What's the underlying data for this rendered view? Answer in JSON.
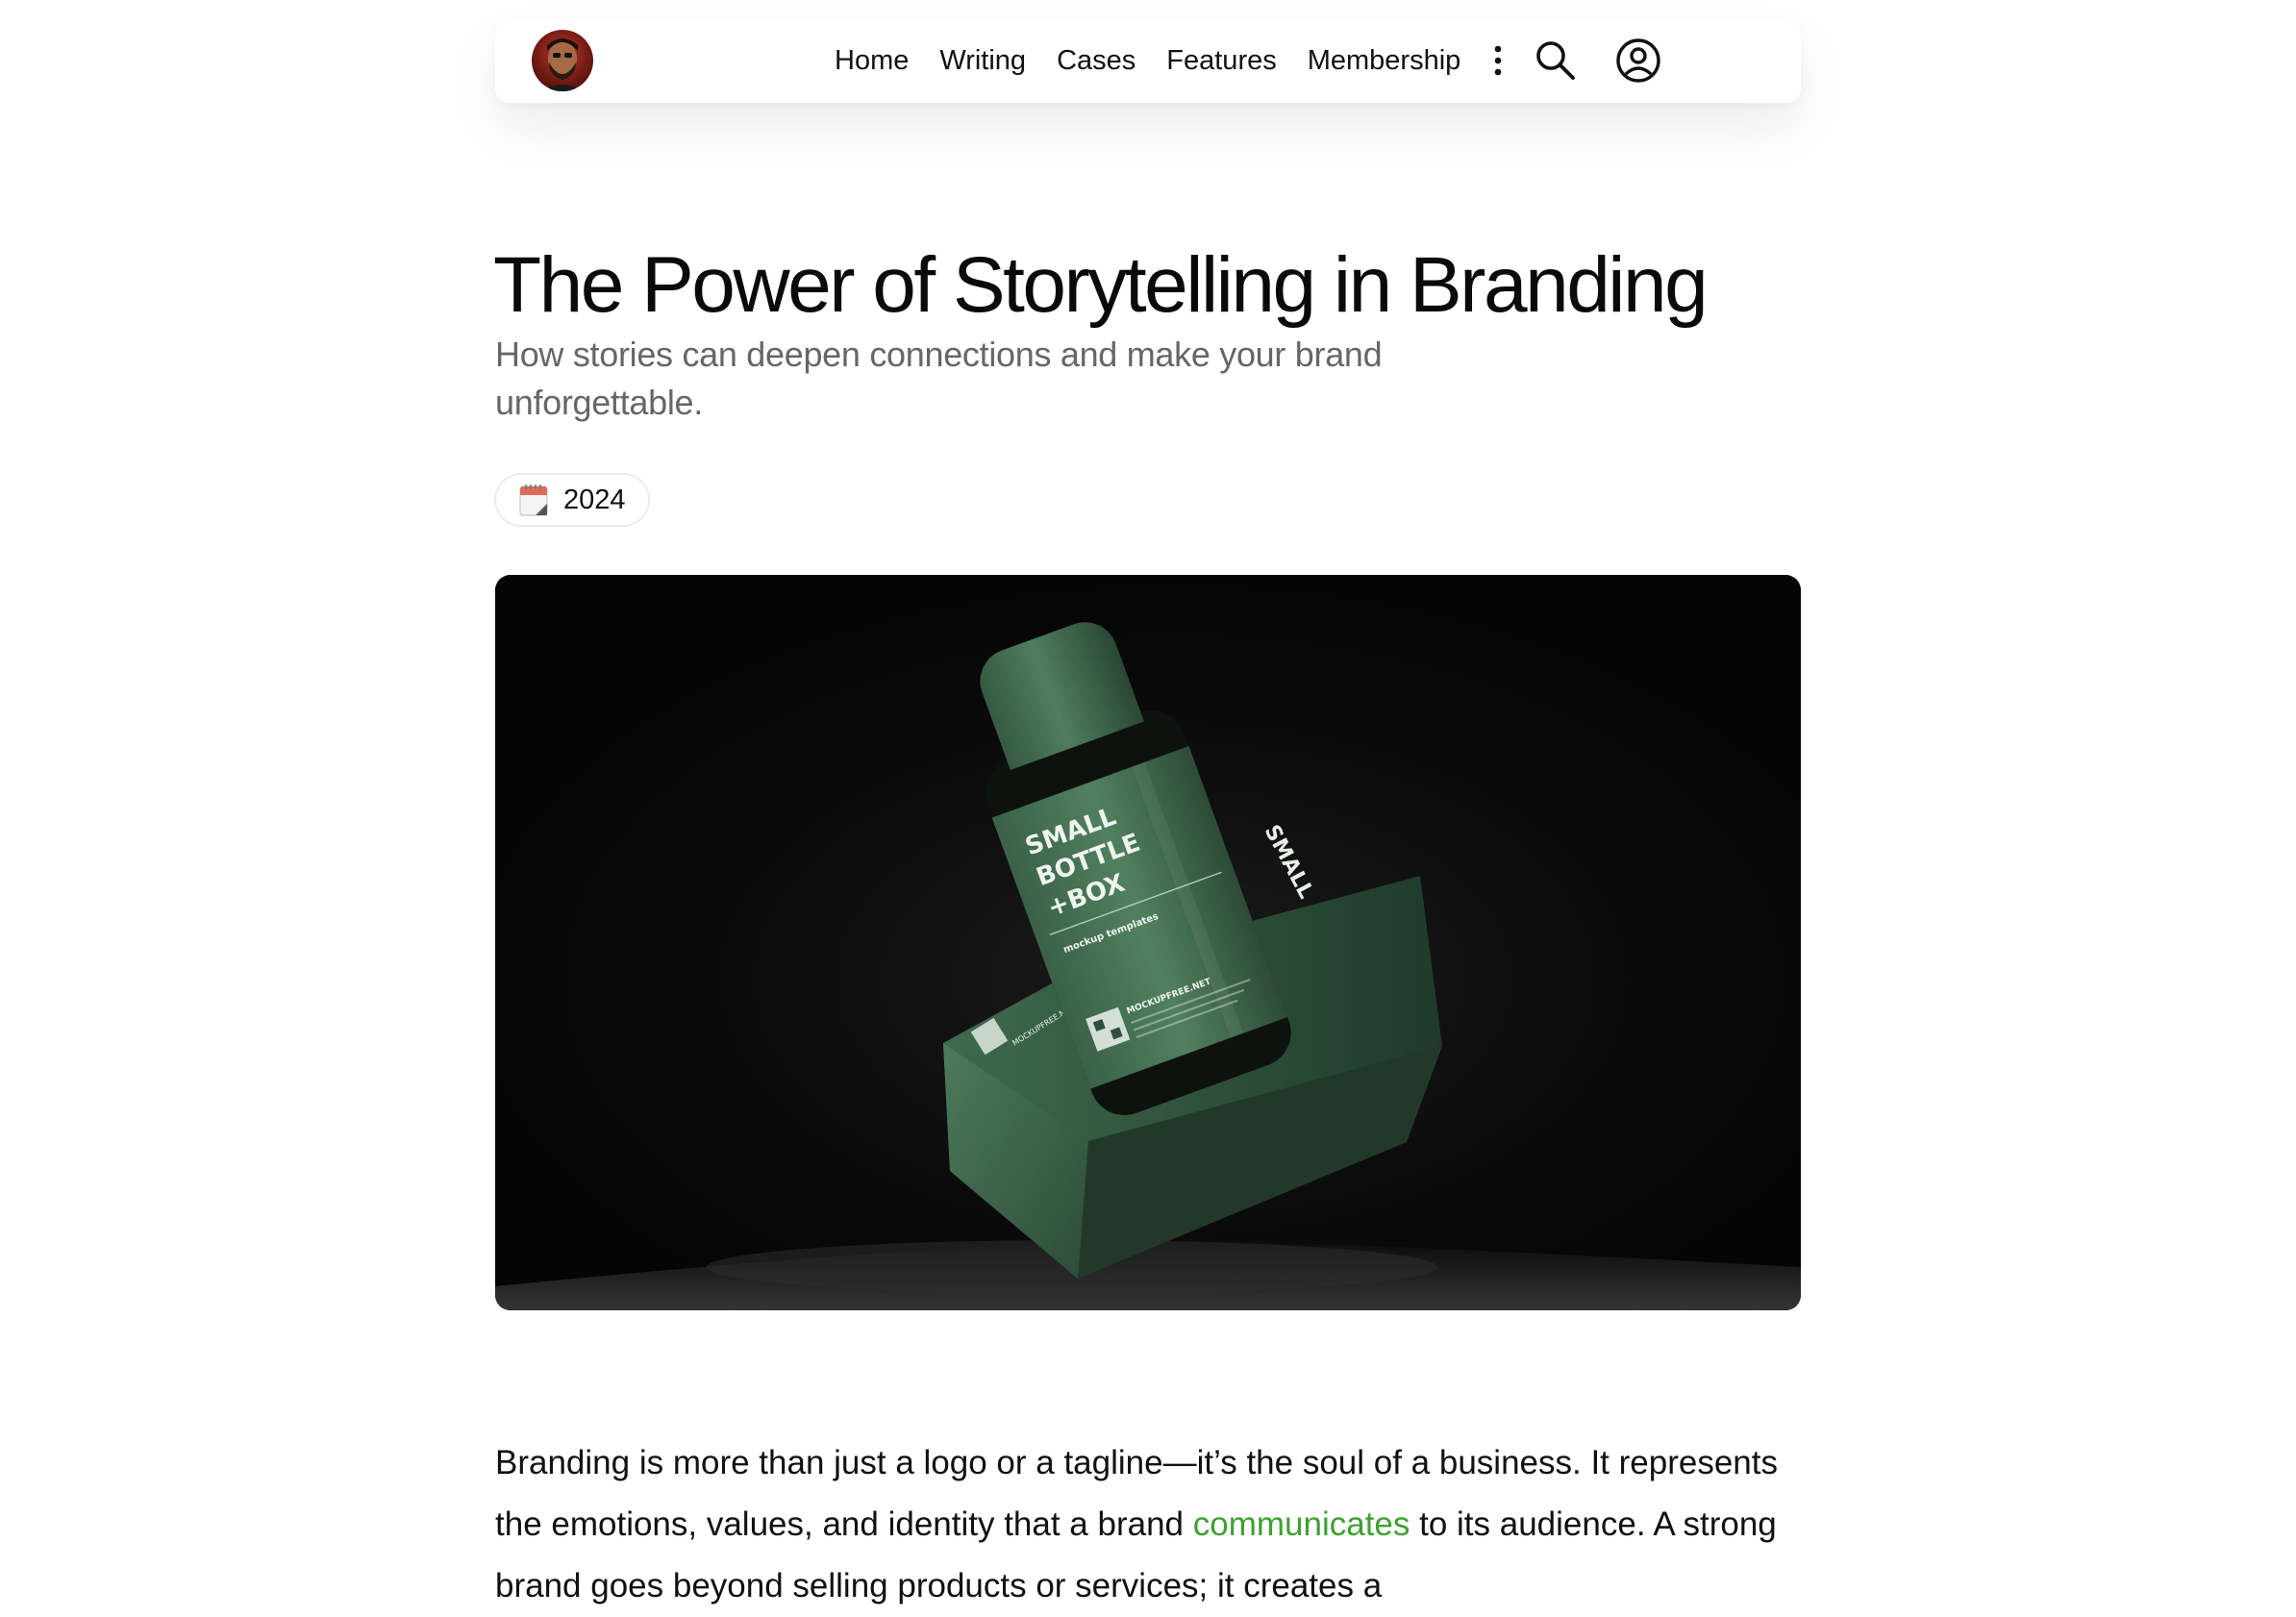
{
  "nav": {
    "avatar_alt": "Author avatar",
    "items": [
      {
        "label": "Home"
      },
      {
        "label": "Writing"
      },
      {
        "label": "Cases"
      },
      {
        "label": "Features"
      },
      {
        "label": "Membership"
      }
    ],
    "icons": [
      "more-vertical-icon",
      "search-icon",
      "user-account-icon"
    ]
  },
  "article": {
    "title": "The Power of Storytelling in Branding",
    "subtitle": "How stories can deepen connections and make your brand unforgettable.",
    "year": "2024",
    "hero": {
      "bottle_label": [
        "SMALL",
        "BOTTLE",
        "+BOX"
      ],
      "bottle_sublabel": "mockup templates",
      "bottle_site": "MOCKUPFREE.NET",
      "box_site": "MOCKUPFREE.NET",
      "box_word": "SMALL"
    },
    "body": {
      "text_before": "Branding is more than just a logo or a tagline—it’s the soul of a business. It represents the emotions, values, and identity that a brand ",
      "link_text": "communicates",
      "text_after": " to its audience. A strong brand goes beyond selling products or services; it creates a"
    }
  },
  "colors": {
    "accent_link": "#3ea12f",
    "product_green": "#3f6b4e",
    "subtitle_gray": "#666666"
  }
}
